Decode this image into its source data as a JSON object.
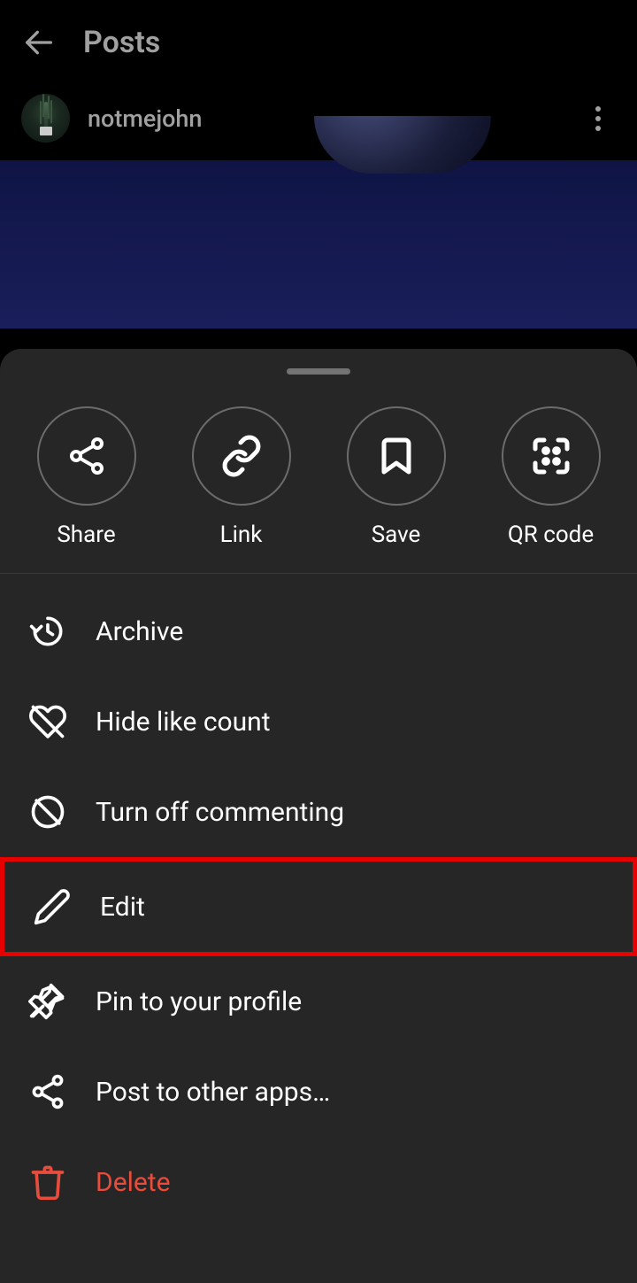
{
  "header": {
    "title": "Posts"
  },
  "post": {
    "username": "notmejohn"
  },
  "sheet": {
    "topActions": [
      {
        "label": "Share",
        "icon": "share"
      },
      {
        "label": "Link",
        "icon": "link"
      },
      {
        "label": "Save",
        "icon": "bookmark"
      },
      {
        "label": "QR code",
        "icon": "qr"
      }
    ],
    "menu": [
      {
        "label": "Archive",
        "icon": "archive",
        "highlighted": false
      },
      {
        "label": "Hide like count",
        "icon": "heart-off",
        "highlighted": false
      },
      {
        "label": "Turn off commenting",
        "icon": "comment-off",
        "highlighted": false
      },
      {
        "label": "Edit",
        "icon": "pencil",
        "highlighted": true
      },
      {
        "label": "Pin to your profile",
        "icon": "pin",
        "highlighted": false
      },
      {
        "label": "Post to other apps…",
        "icon": "share-nodes",
        "highlighted": false
      },
      {
        "label": "Delete",
        "icon": "trash",
        "danger": true,
        "highlighted": false
      }
    ]
  }
}
